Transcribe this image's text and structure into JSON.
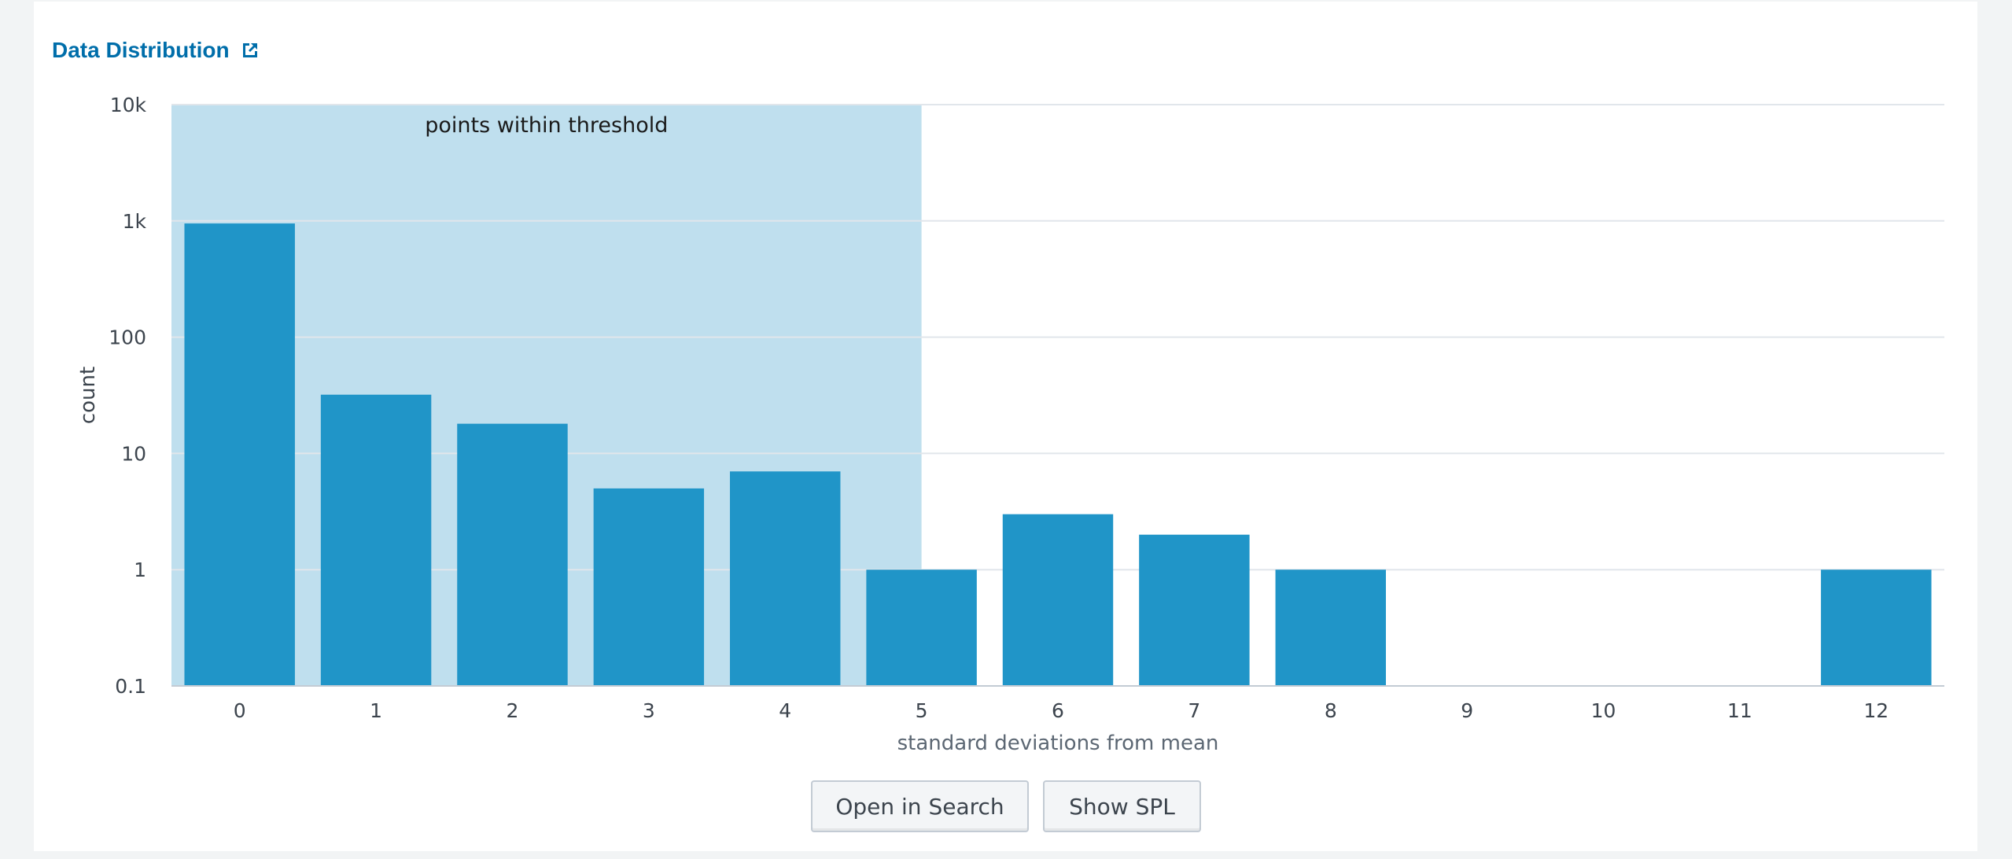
{
  "panel": {
    "title": "Data Distribution",
    "title_icon": "external-link-icon",
    "accent_color": "#006eaa"
  },
  "chart_data": {
    "type": "bar",
    "xlabel": "standard deviations from mean",
    "ylabel": "count",
    "y_scale": "log",
    "ylim": [
      0.1,
      10000
    ],
    "y_ticks": [
      {
        "value": 0.1,
        "label": "0.1"
      },
      {
        "value": 1,
        "label": "1"
      },
      {
        "value": 10,
        "label": "10"
      },
      {
        "value": 100,
        "label": "100"
      },
      {
        "value": 1000,
        "label": "1k"
      },
      {
        "value": 10000,
        "label": "10k"
      }
    ],
    "categories": [
      "0",
      "1",
      "2",
      "3",
      "4",
      "5",
      "6",
      "7",
      "8",
      "9",
      "10",
      "11",
      "12"
    ],
    "values": [
      950,
      32,
      18,
      5,
      7,
      1,
      3,
      2,
      1,
      null,
      null,
      null,
      1
    ],
    "bar_color": "#2095c8",
    "grid": true,
    "annotation": {
      "label": "points within threshold",
      "x_range": [
        0,
        5
      ],
      "color": "#bfdfee"
    }
  },
  "buttons": {
    "open_in_search": "Open in Search",
    "show_spl": "Show SPL"
  }
}
